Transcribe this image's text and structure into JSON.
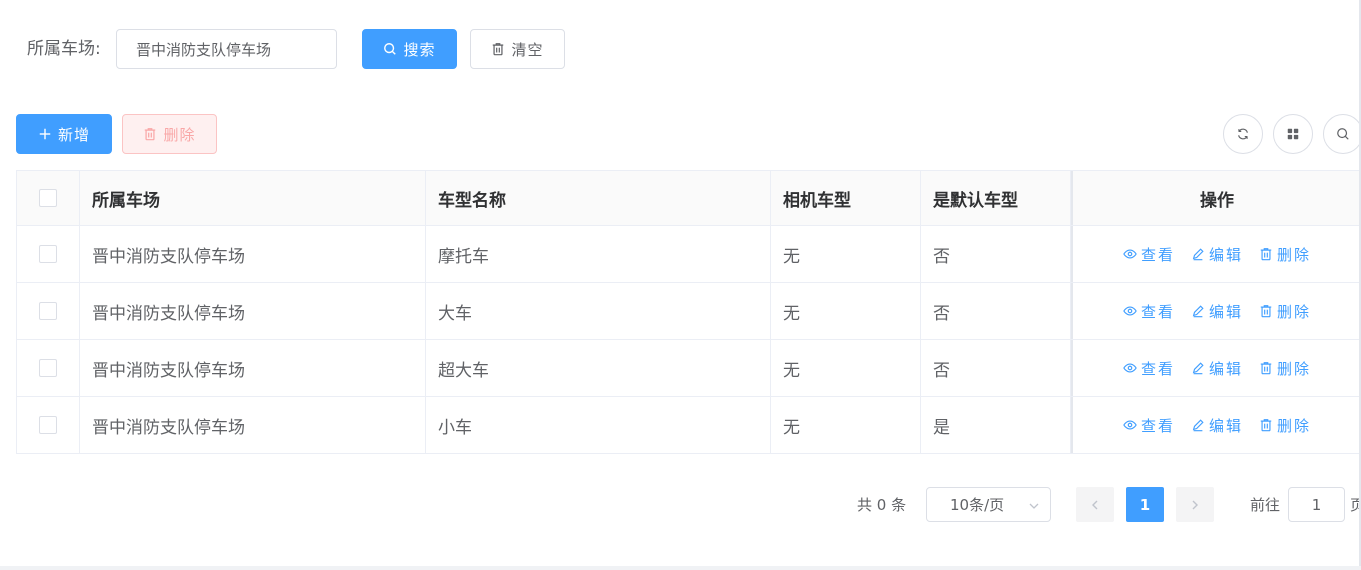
{
  "search": {
    "label": "所属车场:",
    "value": "晋中消防支队停车场",
    "search_button": "搜索",
    "clear_button": "清空"
  },
  "toolbar": {
    "add_button": "新增",
    "delete_button": "删除",
    "icons": [
      "refresh-icon",
      "grid-icon",
      "search-icon"
    ]
  },
  "table": {
    "columns": [
      "所属车场",
      "车型名称",
      "相机车型",
      "是默认车型",
      "操作"
    ],
    "rows": [
      {
        "lot": "晋中消防支队停车场",
        "name": "摩托车",
        "camera": "无",
        "default": "否"
      },
      {
        "lot": "晋中消防支队停车场",
        "name": "大车",
        "camera": "无",
        "default": "否"
      },
      {
        "lot": "晋中消防支队停车场",
        "name": "超大车",
        "camera": "无",
        "default": "否"
      },
      {
        "lot": "晋中消防支队停车场",
        "name": "小车",
        "camera": "无",
        "default": "是"
      }
    ],
    "ops": {
      "view": "查看",
      "edit": "编辑",
      "delete": "删除"
    }
  },
  "pagination": {
    "total": "共 0 条",
    "page_size": "10条/页",
    "current_page": "1",
    "goto_label": "前往",
    "goto_value": "1",
    "page_suffix": "页"
  },
  "colors": {
    "primary": "#409eff",
    "danger": "#f56c6c"
  }
}
